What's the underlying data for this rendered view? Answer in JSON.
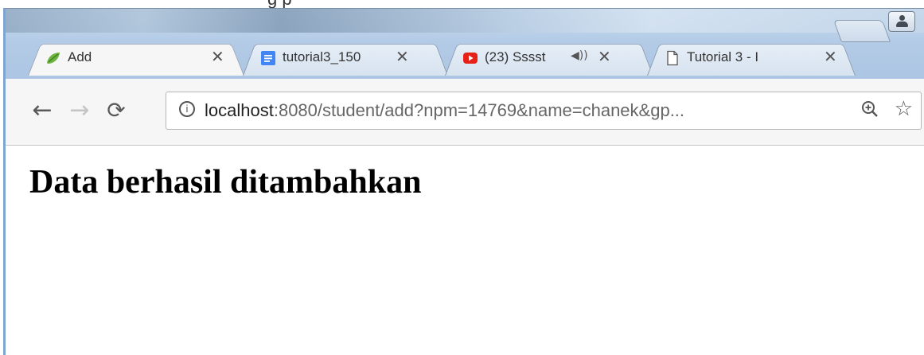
{
  "tabs": [
    {
      "title": "Add",
      "favicon": "spring-leaf-icon",
      "active": true
    },
    {
      "title": "tutorial3_150",
      "favicon": "google-docs-icon",
      "active": false
    },
    {
      "title": "(23) Sssst",
      "favicon": "youtube-icon",
      "active": false,
      "audio": true
    },
    {
      "title": "Tutorial 3 - I",
      "favicon": "page-icon",
      "active": false
    }
  ],
  "toolbar": {
    "url_host": "localhost",
    "url_rest": ":8080/student/add?npm=14769&name=chanek&gp..."
  },
  "page": {
    "heading": "Data berhasil ditambahkan"
  },
  "colors": {
    "frame": "#a9c3e2",
    "tab_active": "#f6f6f6",
    "toolbar": "#f6f6f6"
  }
}
